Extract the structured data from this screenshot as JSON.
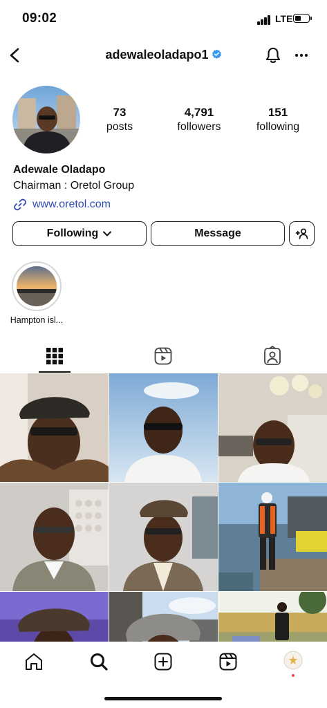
{
  "status_bar": {
    "time": "09:02",
    "network": "LTE"
  },
  "header": {
    "username": "adewaleoladapo1"
  },
  "profile": {
    "stats": [
      {
        "value": "73",
        "label": "posts"
      },
      {
        "value": "4,791",
        "label": "followers"
      },
      {
        "value": "151",
        "label": "following"
      }
    ],
    "name": "Adewale Oladapo",
    "bio": "Chairman : Oretol Group",
    "link": "www.oretol.com"
  },
  "actions": {
    "following_label": "Following",
    "message_label": "Message"
  },
  "highlights": [
    {
      "label": "Hampton isl..."
    }
  ],
  "tabs": [
    "posts-grid",
    "reels",
    "tagged"
  ],
  "nav": [
    "home",
    "search",
    "create",
    "reels",
    "profile"
  ],
  "colors": {
    "link": "#2f4bb5",
    "verified": "#3897f0",
    "profile_dot": "#ed4956"
  }
}
